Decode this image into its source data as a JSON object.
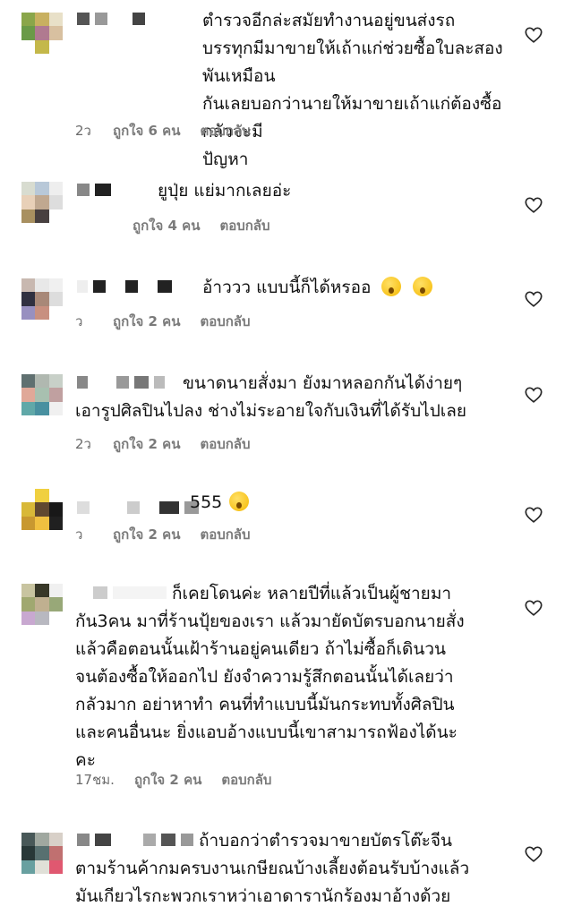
{
  "comments": [
    {
      "text": "ตำรวจอีกล่ะสมัยทำงานอยู่ขนส่งรถ\nบรรทุกมีมาขายให้เถ้าแก่ช่วยซื้อใบละสองพันเหมือน\nกันเลยบอกว่านายให้มาขายเถ้าแก่ต้องซื้อกลัวจะมี\nปัญหา",
      "time": "2ว",
      "likes": "ถูกใจ 6 คน",
      "reply": "ตอบกลับ"
    },
    {
      "text": "ยูปุ่ย แย่มากเลยอ่ะ",
      "time": "",
      "likes": "ถูกใจ 4 คน",
      "reply": "ตอบกลับ"
    },
    {
      "text": "อ้าววว แบบนี้ก็ได้หรออ",
      "time": "ว",
      "likes": "ถูกใจ 2 คน",
      "reply": "ตอบกลับ"
    },
    {
      "text": "ขนาดนายสั่งมา ยังมาหลอกกันได้ง่ายๆ\nเอารูปศิลปินไปลง ช่างไม่ระอายใจกับเงินที่ได้รับไปเลย",
      "time": "2ว",
      "likes": "ถูกใจ 2 คน",
      "reply": "ตอบกลับ"
    },
    {
      "text": "555",
      "time": "ว",
      "likes": "ถูกใจ 2 คน",
      "reply": "ตอบกลับ"
    },
    {
      "text": "ก็เคยโดนค่ะ หลายปีที่แล้วเป็นผู้ชายมา\nกัน3คน มาที่ร้านปุ้ยของเรา แล้วมายัดบัตรบอกนายสั่ง\nแล้วคือตอนนั้นเฝ้าร้านอยู่คนเดียว ถ้าไม่ซื้อก็เดินวน\nจนต้องซื้อให้ออกไป ยังจำความรู้สึกตอนนั้นได้เลยว่า\nกลัวมาก อย่าหาทำ คนที่ทำแบบนี้มันกระทบทั้งศิลปิน\nและคนอื่นนะ ยิ่งแอบอ้างแบบนี้เขาสามารถฟ้องได้นะ\nคะ",
      "time": "17ชม.",
      "likes": "ถูกใจ 2 คน",
      "reply": "ตอบกลับ"
    },
    {
      "text": "ถ้าบอกว่าตำรวจมาขายบัตรโต๊ะจีน\nตามร้านค้ากมครบงานเกษียณบ้างเลี้ยงต้อนรับบ้างแล้ว\nมันเกียวไรกะพวกเราหว่าเอาดารานักร้องมาอ้างด้วย",
      "time": "",
      "likes": "",
      "reply": ""
    }
  ],
  "icons": {
    "like": "heart-outline-icon",
    "emoji_astonished": "astonished-face-emoji",
    "emoji_smirk": "smirking-face-emoji"
  },
  "colors": {
    "meta_text": "#6b6b6b",
    "heart_stroke": "#262626"
  }
}
